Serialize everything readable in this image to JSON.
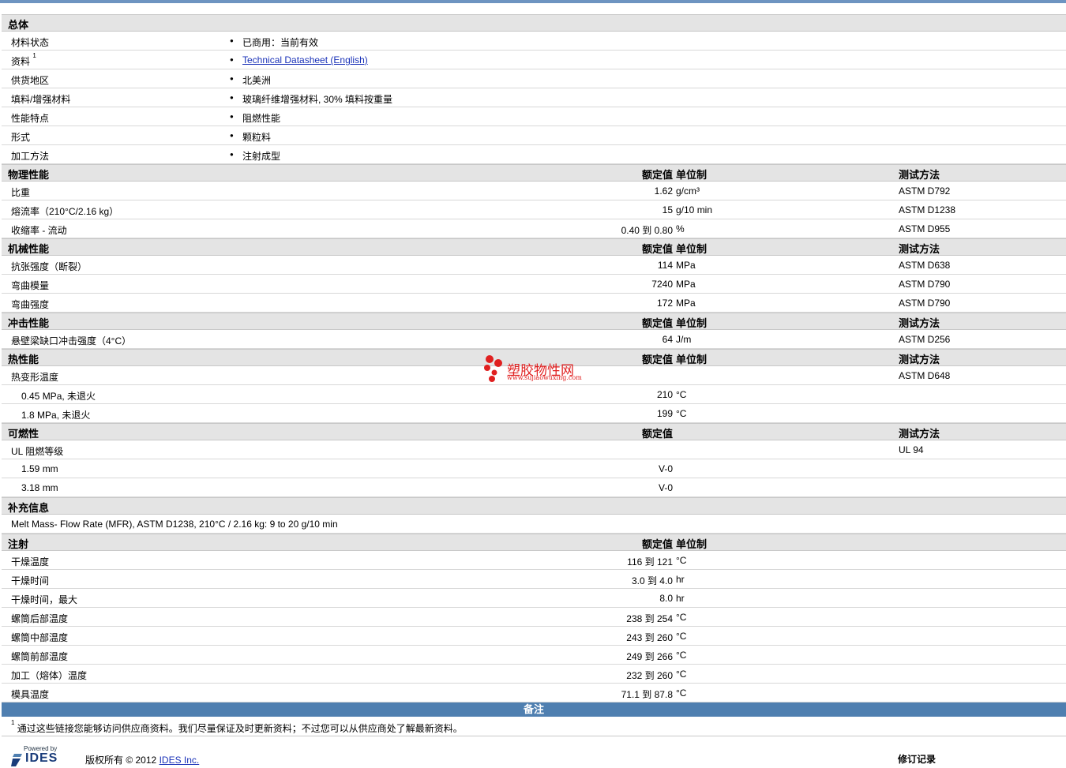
{
  "general": {
    "header": "总体",
    "items": [
      {
        "label": "材料状态",
        "sup": "",
        "value": "已商用：当前有效",
        "link": false
      },
      {
        "label": "资料",
        "sup": "1",
        "value": "Technical Datasheet (English)",
        "link": true
      },
      {
        "label": "供货地区",
        "sup": "",
        "value": "北美洲",
        "link": false
      },
      {
        "label": "填料/增强材料",
        "sup": "",
        "value": "玻璃纤维增强材料, 30% 填料按重量",
        "link": false
      },
      {
        "label": "性能特点",
        "sup": "",
        "value": "阻燃性能",
        "link": false
      },
      {
        "label": "形式",
        "sup": "",
        "value": "颗粒料",
        "link": false
      },
      {
        "label": "加工方法",
        "sup": "",
        "value": "注射成型",
        "link": false
      }
    ]
  },
  "sections": [
    {
      "title": "物理性能",
      "col_value": "额定值",
      "col_unit": "单位制",
      "col_test": "测试方法",
      "rows": [
        {
          "name": "比重",
          "value": "1.62",
          "unit": "g/cm³",
          "test": "ASTM D792"
        },
        {
          "name": "熔流率（210°C/2.16 kg）",
          "value": "15",
          "unit": "g/10 min",
          "test": "ASTM D1238"
        },
        {
          "name": "收缩率 - 流动",
          "value": "0.40 到  0.80",
          "unit": "%",
          "test": "ASTM D955"
        }
      ]
    },
    {
      "title": "机械性能",
      "col_value": "额定值",
      "col_unit": "单位制",
      "col_test": "测试方法",
      "rows": [
        {
          "name": "抗张强度（断裂）",
          "value": "114",
          "unit": "MPa",
          "test": "ASTM D638"
        },
        {
          "name": "弯曲模量",
          "value": "7240",
          "unit": "MPa",
          "test": "ASTM D790"
        },
        {
          "name": "弯曲强度",
          "value": "172",
          "unit": "MPa",
          "test": "ASTM D790"
        }
      ]
    },
    {
      "title": "冲击性能",
      "col_value": "额定值",
      "col_unit": "单位制",
      "col_test": "测试方法",
      "rows": [
        {
          "name": "悬壁梁缺口冲击强度（4°C）",
          "value": "64",
          "unit": "J/m",
          "test": "ASTM D256"
        }
      ]
    },
    {
      "title": "热性能",
      "col_value": "额定值",
      "col_unit": "单位制",
      "col_test": "测试方法",
      "rows": [
        {
          "name": "热变形温度",
          "value": "",
          "unit": "",
          "test": "ASTM D648"
        },
        {
          "name": "0.45 MPa, 未退火",
          "sub": true,
          "value": "210",
          "unit": "°C",
          "test": ""
        },
        {
          "name": "1.8 MPa, 未退火",
          "sub": true,
          "value": "199",
          "unit": "°C",
          "test": ""
        }
      ]
    },
    {
      "title": "可燃性",
      "col_value": "额定值",
      "col_unit": "",
      "col_test": "测试方法",
      "rows": [
        {
          "name": "UL 阻燃等级",
          "value": "",
          "unit": "",
          "test": "UL 94"
        },
        {
          "name": "1.59 mm",
          "sub": true,
          "value": "V-0",
          "unit": "",
          "test": ""
        },
        {
          "name": "3.18 mm",
          "sub": true,
          "value": "V-0",
          "unit": "",
          "test": ""
        }
      ]
    },
    {
      "title": "补充信息",
      "col_value": "",
      "col_unit": "",
      "col_test": "",
      "rows": [
        {
          "name": "Melt Mass- Flow Rate (MFR), ASTM D1238, 210°C / 2.16 kg: 9 to 20 g/10 min",
          "value": "",
          "unit": "",
          "test": ""
        }
      ]
    },
    {
      "title": "注射",
      "col_value": "额定值",
      "col_unit": "单位制",
      "col_test": "",
      "rows": [
        {
          "name": "干燥温度",
          "value": "116 到  121",
          "unit": "°C",
          "test": ""
        },
        {
          "name": "干燥时间",
          "value": "3.0 到  4.0",
          "unit": "hr",
          "test": ""
        },
        {
          "name": "干燥时间，最大",
          "value": "8.0",
          "unit": "hr",
          "test": ""
        },
        {
          "name": "螺筒后部温度",
          "value": "238 到  254",
          "unit": "°C",
          "test": ""
        },
        {
          "name": "螺筒中部温度",
          "value": "243 到  260",
          "unit": "°C",
          "test": ""
        },
        {
          "name": "螺筒前部温度",
          "value": "249 到  266",
          "unit": "°C",
          "test": ""
        },
        {
          "name": "加工（熔体）温度",
          "value": "232 到  260",
          "unit": "°C",
          "test": ""
        },
        {
          "name": "模具温度",
          "value": "71.1 到  87.8",
          "unit": "°C",
          "test": ""
        }
      ]
    }
  ],
  "notes": {
    "header": "备注",
    "footnote_mark": "1",
    "footnote_text": "通过这些链接您能够访问供应商资料。我们尽量保证及时更新资料；不过您可以从供应商处了解最新资料。"
  },
  "footer": {
    "powered_by": "Powered by",
    "logo_text": "IDES",
    "copyright": "版权所有 © 2012",
    "company_link": "IDES Inc.",
    "revision": "修订记录"
  },
  "watermark": {
    "title": "塑胶物性网",
    "url": "www.sujiaowuxing.com"
  },
  "colors": {
    "top_bar": "#6e94c1",
    "section_bg": "#e4e4e4",
    "notes_bar": "#4f7fb0",
    "link": "#1a32b8",
    "watermark": "#e02020"
  }
}
